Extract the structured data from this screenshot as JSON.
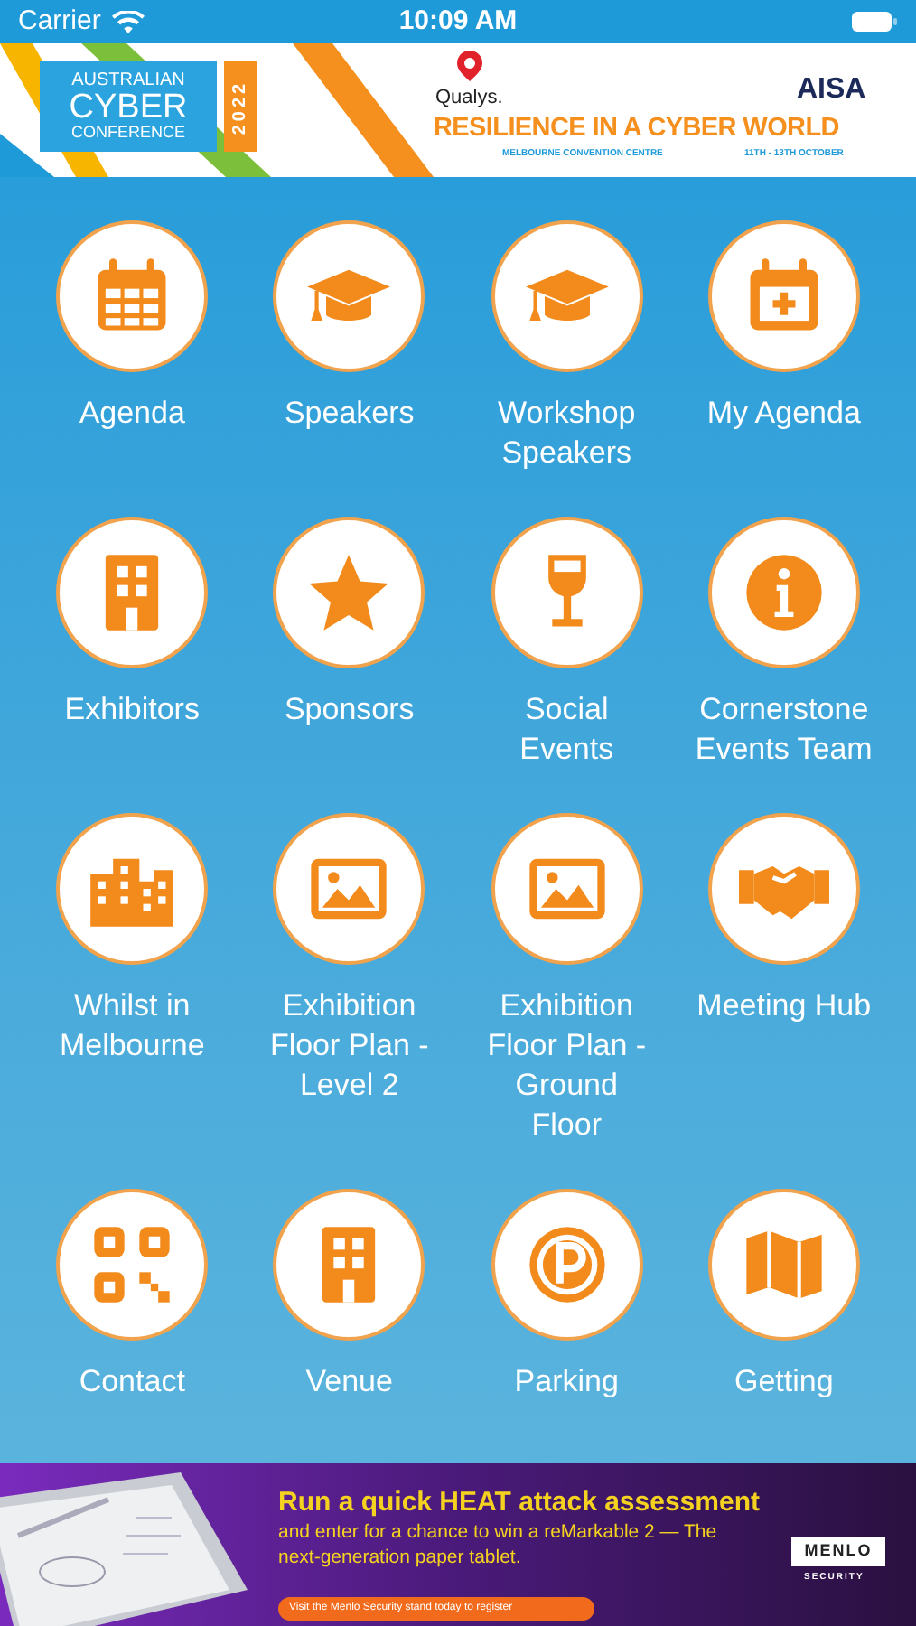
{
  "status_bar": {
    "carrier": "Carrier",
    "time": "10:09 AM"
  },
  "banner": {
    "logo_lines": [
      "AUSTRALIAN",
      "CYBER",
      "CONFERENCE"
    ],
    "logo_year": "2022",
    "sponsor": "Qualys.",
    "partner": "AISA",
    "headline": "RESILIENCE IN A CYBER WORLD",
    "venue": "MELBOURNE CONVENTION CENTRE",
    "dates": "11TH - 13TH OCTOBER"
  },
  "menu": [
    {
      "label": "Agenda"
    },
    {
      "label": "Speakers"
    },
    {
      "label": "Workshop Speakers"
    },
    {
      "label": "My Agenda"
    },
    {
      "label": "Exhibitors"
    },
    {
      "label": "Sponsors"
    },
    {
      "label": "Social Events"
    },
    {
      "label": "Cornerstone Events Team"
    },
    {
      "label": "Whilst in Melbourne"
    },
    {
      "label": "Exhibition Floor Plan - Level 2"
    },
    {
      "label": "Exhibition Floor Plan - Ground Floor"
    },
    {
      "label": "Meeting Hub"
    },
    {
      "label": "Contact"
    },
    {
      "label": "Venue"
    },
    {
      "label": "Parking"
    },
    {
      "label": "Getting"
    }
  ],
  "ad": {
    "headline": "Run a quick HEAT attack assessment",
    "body": "and enter for a chance to win a reMarkable 2 — The next-generation paper tablet.",
    "cta": "Visit the Menlo Security stand today to register",
    "brand": "MENLO",
    "brand_sub": "SECURITY"
  }
}
